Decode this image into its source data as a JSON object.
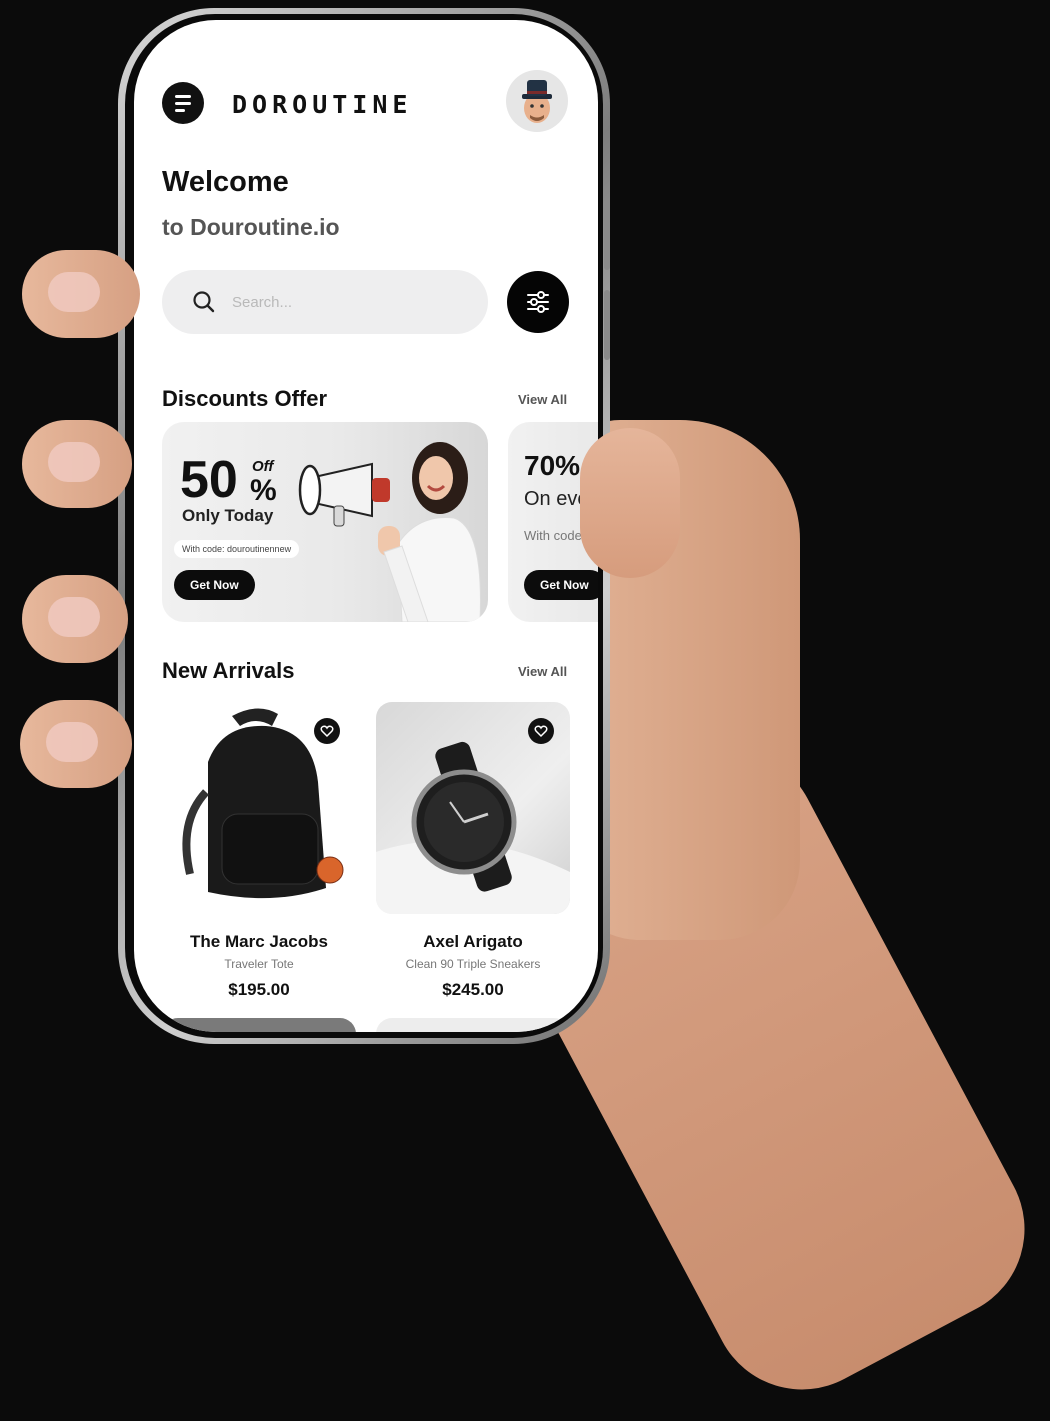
{
  "header": {
    "logo": "DOROUTINE"
  },
  "welcome": {
    "title": "Welcome",
    "subtitle": "to Douroutine.io"
  },
  "search": {
    "placeholder": "Search..."
  },
  "discounts": {
    "title": "Discounts Offer",
    "view_all": "View All",
    "offers": [
      {
        "percent": "50",
        "percent_sign": "%",
        "off": "Off",
        "tagline": "Only Today",
        "code": "With code: douroutinennew",
        "button": "Get Now"
      },
      {
        "percent": "70%",
        "tagline": "On eve",
        "code": "With code",
        "button": "Get Now"
      }
    ]
  },
  "arrivals": {
    "title": "New Arrivals",
    "view_all": "View All",
    "products": [
      {
        "name": "The Marc Jacobs",
        "subtitle": "Traveler Tote",
        "price": "$195.00"
      },
      {
        "name": "Axel Arigato",
        "subtitle": "Clean 90 Triple Sneakers",
        "price": "$245.00"
      }
    ]
  },
  "colors": {
    "background": "#0b0b0b",
    "accent": "#111111",
    "screen": "#ffffff"
  },
  "icons": [
    "menu-icon",
    "avatar",
    "search-icon",
    "filter-icon",
    "megaphone-icon",
    "heart-icon"
  ]
}
